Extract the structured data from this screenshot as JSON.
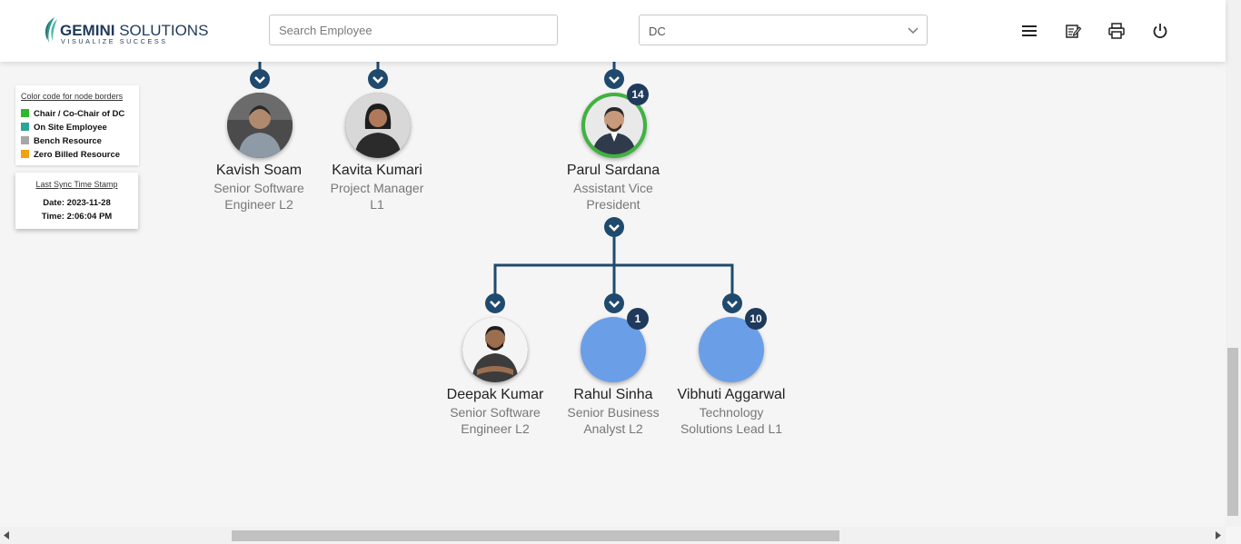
{
  "header": {
    "logo": {
      "brand": "GEMINI",
      "brand_rest": "SOLUTIONS",
      "tagline": "VISUALIZE SUCCESS"
    },
    "search": {
      "placeholder": "Search Employee",
      "value": ""
    },
    "department_select": {
      "value": "DC"
    },
    "icons": [
      "menu-icon",
      "notes-icon",
      "print-icon",
      "power-icon"
    ]
  },
  "legend": {
    "title": "Color code for node borders",
    "items": [
      {
        "label": "Chair / Co-Chair of DC",
        "color": "#2db82d"
      },
      {
        "label": "On Site Employee",
        "color": "#2aa59a"
      },
      {
        "label": "Bench Resource",
        "color": "#a6a6a6"
      },
      {
        "label": "Zero Billed Resource",
        "color": "#f2a10f"
      }
    ]
  },
  "sync": {
    "title": "Last Sync Time Stamp",
    "date": "Date: 2023-11-28",
    "time": "Time: 2:06:04 PM"
  },
  "colors": {
    "connector": "#1f4a6e",
    "badge": "#1f3a5a",
    "avatar_placeholder": "#6a9fe8",
    "chair_border": "#3fb33f"
  },
  "employees": [
    {
      "name": "Kavish Soam",
      "title_line1": "Senior Software",
      "title_line2": "Engineer L2",
      "badge": "",
      "avatar": "photo"
    },
    {
      "name": "Kavita Kumari",
      "title_line1": "Project Manager",
      "title_line2": "L1",
      "badge": "",
      "avatar": "photo"
    },
    {
      "name": "Parul Sardana",
      "title_line1": "Assistant Vice",
      "title_line2": "President",
      "badge": "14",
      "avatar": "photo",
      "border": "chair"
    },
    {
      "name": "Deepak Kumar",
      "title_line1": "Senior Software",
      "title_line2": "Engineer L2",
      "badge": "",
      "avatar": "photo"
    },
    {
      "name": "Rahul Sinha",
      "title_line1": "Senior Business",
      "title_line2": "Analyst L2",
      "badge": "1",
      "avatar": "blank"
    },
    {
      "name": "Vibhuti Aggarwal",
      "title_line1": "Technology",
      "title_line2": "Solutions Lead L1",
      "badge": "10",
      "avatar": "blank"
    }
  ]
}
